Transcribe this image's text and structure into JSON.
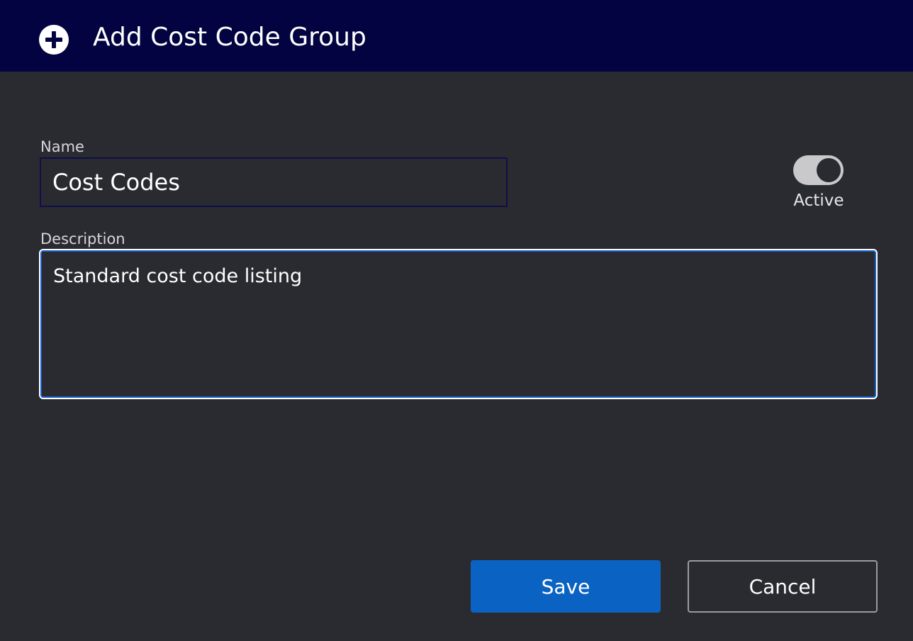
{
  "dialog": {
    "title": "Add Cost Code Group",
    "header_icon": "plus-circle-icon"
  },
  "form": {
    "name_label": "Name",
    "name_value": "Cost Codes",
    "description_label": "Description",
    "description_value": "Standard cost code listing",
    "active_label": "Active",
    "active_on": true
  },
  "actions": {
    "save_label": "Save",
    "cancel_label": "Cancel"
  },
  "colors": {
    "header_bg": "#020340",
    "body_bg": "#2a2a31",
    "primary": "#0a63c2",
    "focus": "#1a62c9"
  }
}
